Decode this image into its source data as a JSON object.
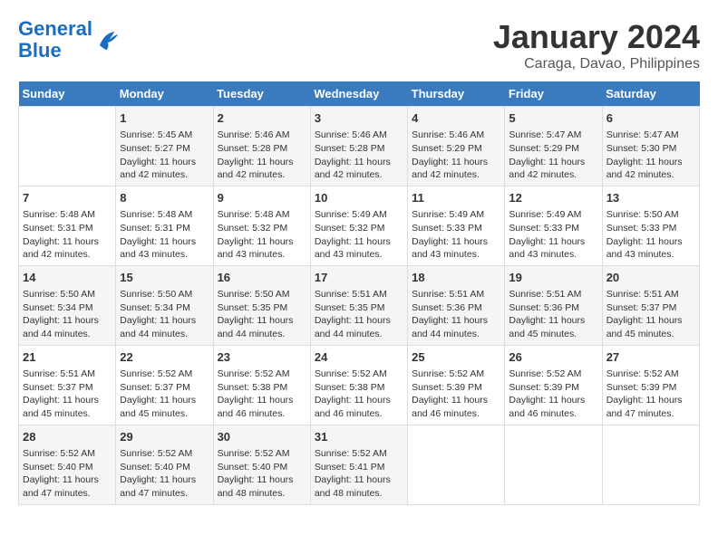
{
  "logo": {
    "line1": "General",
    "line2": "Blue"
  },
  "title": "January 2024",
  "subtitle": "Caraga, Davao, Philippines",
  "days_header": [
    "Sunday",
    "Monday",
    "Tuesday",
    "Wednesday",
    "Thursday",
    "Friday",
    "Saturday"
  ],
  "weeks": [
    [
      {
        "day": "",
        "info": ""
      },
      {
        "day": "1",
        "info": "Sunrise: 5:45 AM\nSunset: 5:27 PM\nDaylight: 11 hours\nand 42 minutes."
      },
      {
        "day": "2",
        "info": "Sunrise: 5:46 AM\nSunset: 5:28 PM\nDaylight: 11 hours\nand 42 minutes."
      },
      {
        "day": "3",
        "info": "Sunrise: 5:46 AM\nSunset: 5:28 PM\nDaylight: 11 hours\nand 42 minutes."
      },
      {
        "day": "4",
        "info": "Sunrise: 5:46 AM\nSunset: 5:29 PM\nDaylight: 11 hours\nand 42 minutes."
      },
      {
        "day": "5",
        "info": "Sunrise: 5:47 AM\nSunset: 5:29 PM\nDaylight: 11 hours\nand 42 minutes."
      },
      {
        "day": "6",
        "info": "Sunrise: 5:47 AM\nSunset: 5:30 PM\nDaylight: 11 hours\nand 42 minutes."
      }
    ],
    [
      {
        "day": "7",
        "info": "Sunrise: 5:48 AM\nSunset: 5:31 PM\nDaylight: 11 hours\nand 42 minutes."
      },
      {
        "day": "8",
        "info": "Sunrise: 5:48 AM\nSunset: 5:31 PM\nDaylight: 11 hours\nand 43 minutes."
      },
      {
        "day": "9",
        "info": "Sunrise: 5:48 AM\nSunset: 5:32 PM\nDaylight: 11 hours\nand 43 minutes."
      },
      {
        "day": "10",
        "info": "Sunrise: 5:49 AM\nSunset: 5:32 PM\nDaylight: 11 hours\nand 43 minutes."
      },
      {
        "day": "11",
        "info": "Sunrise: 5:49 AM\nSunset: 5:33 PM\nDaylight: 11 hours\nand 43 minutes."
      },
      {
        "day": "12",
        "info": "Sunrise: 5:49 AM\nSunset: 5:33 PM\nDaylight: 11 hours\nand 43 minutes."
      },
      {
        "day": "13",
        "info": "Sunrise: 5:50 AM\nSunset: 5:33 PM\nDaylight: 11 hours\nand 43 minutes."
      }
    ],
    [
      {
        "day": "14",
        "info": "Sunrise: 5:50 AM\nSunset: 5:34 PM\nDaylight: 11 hours\nand 44 minutes."
      },
      {
        "day": "15",
        "info": "Sunrise: 5:50 AM\nSunset: 5:34 PM\nDaylight: 11 hours\nand 44 minutes."
      },
      {
        "day": "16",
        "info": "Sunrise: 5:50 AM\nSunset: 5:35 PM\nDaylight: 11 hours\nand 44 minutes."
      },
      {
        "day": "17",
        "info": "Sunrise: 5:51 AM\nSunset: 5:35 PM\nDaylight: 11 hours\nand 44 minutes."
      },
      {
        "day": "18",
        "info": "Sunrise: 5:51 AM\nSunset: 5:36 PM\nDaylight: 11 hours\nand 44 minutes."
      },
      {
        "day": "19",
        "info": "Sunrise: 5:51 AM\nSunset: 5:36 PM\nDaylight: 11 hours\nand 45 minutes."
      },
      {
        "day": "20",
        "info": "Sunrise: 5:51 AM\nSunset: 5:37 PM\nDaylight: 11 hours\nand 45 minutes."
      }
    ],
    [
      {
        "day": "21",
        "info": "Sunrise: 5:51 AM\nSunset: 5:37 PM\nDaylight: 11 hours\nand 45 minutes."
      },
      {
        "day": "22",
        "info": "Sunrise: 5:52 AM\nSunset: 5:37 PM\nDaylight: 11 hours\nand 45 minutes."
      },
      {
        "day": "23",
        "info": "Sunrise: 5:52 AM\nSunset: 5:38 PM\nDaylight: 11 hours\nand 46 minutes."
      },
      {
        "day": "24",
        "info": "Sunrise: 5:52 AM\nSunset: 5:38 PM\nDaylight: 11 hours\nand 46 minutes."
      },
      {
        "day": "25",
        "info": "Sunrise: 5:52 AM\nSunset: 5:39 PM\nDaylight: 11 hours\nand 46 minutes."
      },
      {
        "day": "26",
        "info": "Sunrise: 5:52 AM\nSunset: 5:39 PM\nDaylight: 11 hours\nand 46 minutes."
      },
      {
        "day": "27",
        "info": "Sunrise: 5:52 AM\nSunset: 5:39 PM\nDaylight: 11 hours\nand 47 minutes."
      }
    ],
    [
      {
        "day": "28",
        "info": "Sunrise: 5:52 AM\nSunset: 5:40 PM\nDaylight: 11 hours\nand 47 minutes."
      },
      {
        "day": "29",
        "info": "Sunrise: 5:52 AM\nSunset: 5:40 PM\nDaylight: 11 hours\nand 47 minutes."
      },
      {
        "day": "30",
        "info": "Sunrise: 5:52 AM\nSunset: 5:40 PM\nDaylight: 11 hours\nand 48 minutes."
      },
      {
        "day": "31",
        "info": "Sunrise: 5:52 AM\nSunset: 5:41 PM\nDaylight: 11 hours\nand 48 minutes."
      },
      {
        "day": "",
        "info": ""
      },
      {
        "day": "",
        "info": ""
      },
      {
        "day": "",
        "info": ""
      }
    ]
  ]
}
